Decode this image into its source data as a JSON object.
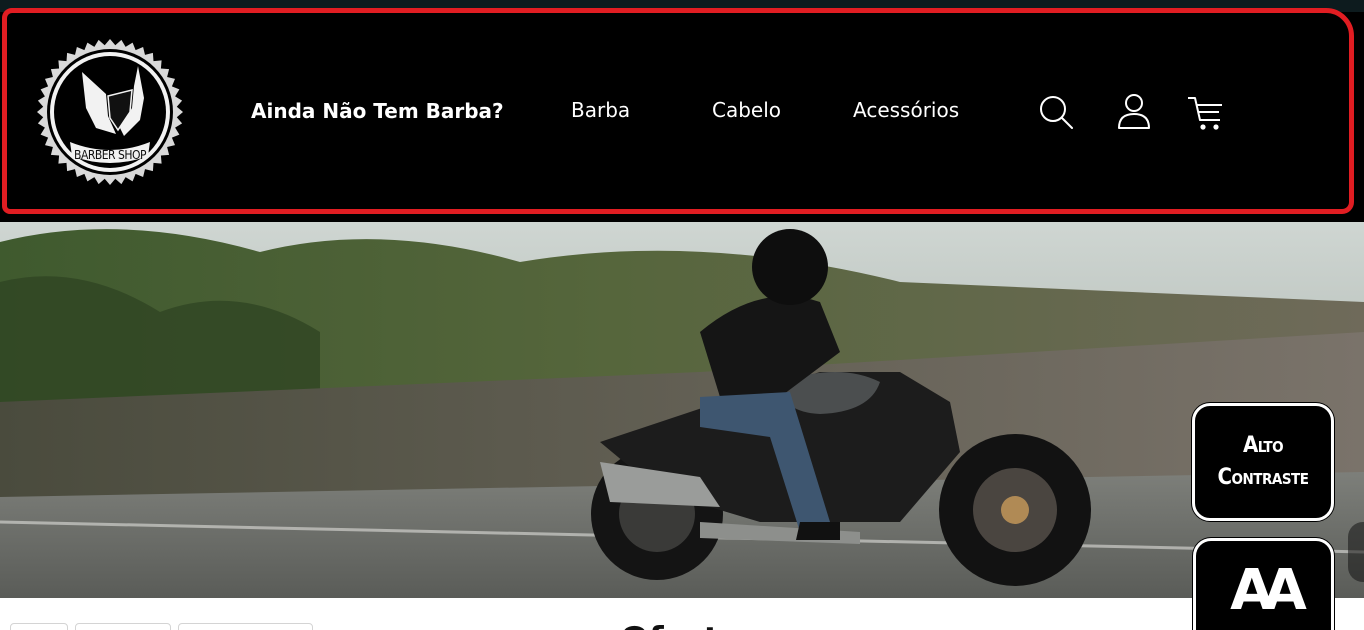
{
  "header": {
    "logo": {
      "text": "BARBER SHOP",
      "icon": "beard-man-icon"
    },
    "nav": [
      {
        "label": "Ainda Não Tem  Barba?"
      },
      {
        "label": "Barba"
      },
      {
        "label": "Cabelo"
      },
      {
        "label": "Acessórios"
      }
    ],
    "icons": [
      "search-icon",
      "user-icon",
      "cart-icon"
    ]
  },
  "hero": {
    "image": "motorcycle-rider-hero-image"
  },
  "section": {
    "title": "Ofert"
  },
  "accessibility": {
    "contrast_line1": "Alto",
    "contrast_line2": "Contraste",
    "font_size_label": "AA"
  },
  "colors": {
    "header_bg": "#000000",
    "highlight_border": "#e11d22",
    "nav_text": "#ffffff",
    "acc_bg": "#000000"
  }
}
